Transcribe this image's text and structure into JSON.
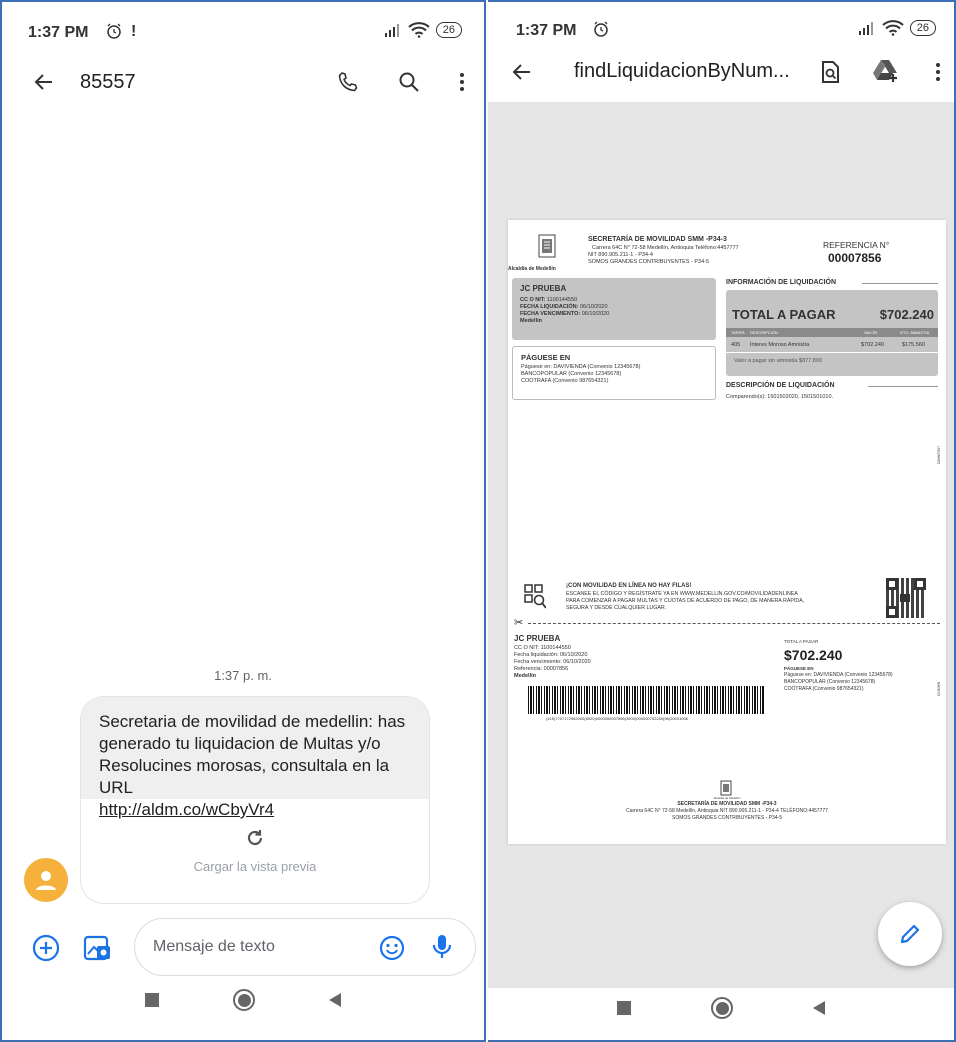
{
  "left_screen": {
    "status": {
      "time": "1:37 PM",
      "alarm_icon": "alarm-icon",
      "alert_mark": "!",
      "battery": "26"
    },
    "appbar": {
      "title": "85557"
    },
    "message": {
      "timestamp": "1:37 p. m.",
      "text": "Secretaria de movilidad de medellin: has generado tu liquidacion de Multas y/o Resolucines morosas, consultala en la URL",
      "link": "http://aldm.co/wCbyVr4",
      "preview_label": "Cargar la vista previa"
    },
    "compose": {
      "placeholder": "Mensaje de texto"
    }
  },
  "right_screen": {
    "status": {
      "time": "1:37 PM",
      "battery": "26"
    },
    "appbar": {
      "title": "findLiquidacionByNum..."
    },
    "doc": {
      "org": "SECRETARÍA DE MOVILIDAD SMM -P34-3",
      "addr1": "Carrera 64C N° 72-58 Medellín, Antioquia Teléfono:4457777",
      "addr2": "NIT 890.905.211-1 - P34-4",
      "addr3": "SOMOS GRANDES CONTRIBUYENTES - P34-5",
      "logo_caption": "Alcaldía de Medellín",
      "ref_label": "REFERENCIA N°",
      "ref_value": "00007856",
      "name": "JC PRUEBA",
      "nit_label": "CC O NIT:",
      "nit": "1100144550",
      "fl_label": "FECHA LIQUIDACIÓN:",
      "fl": "06/10/2020",
      "fv_label": "FECHA VENCIMIENTO:",
      "fv": "06/10/2020",
      "city": "Medellín",
      "info_title": "INFORMACIÓN DE LIQUIDACIÓN",
      "total_label": "TOTAL A PAGAR",
      "total": "$702.240",
      "th_tarifa": "TARIFA",
      "th_desc": "DESCRIPCIÓN",
      "th_valor": "VALOR",
      "th_dto": "DTO. AMNISTÍA",
      "row_tarifa": "405",
      "row_desc": "Interes Moroso Amnistía",
      "row_valor": "$702.240",
      "row_dto": "$175.560",
      "sin_amnistia": "Valor a pagar sin amnistía $877.800",
      "pague_title": "PÁGUESE EN",
      "pague1": "Páguese en: DAVIVIENDA (Convenio 12345678)",
      "pague2": "BANCOPOPULAR (Convenio 12345678)",
      "pague3": "COOTRAFA (Convenio 987654321)",
      "desc_title": "DESCRIPCIÓN DE LIQUIDACIÓN",
      "desc": "Comparendo(s): 1501502020, 1501501010.",
      "side1": "USUARIO",
      "promo_title": "¡CON MOVILIDAD EN LÍNEA NO HAY FILAS!",
      "promo1": "ESCANEE EL CÓDIGO Y REGÍSTRATE YA EN WWW.MEDELLIN.GOV.CO/MOVILIDADENLINEA",
      "promo2": "PARA COMENZAR A PAGAR MULTAS Y CUOTAS DE ACUERDO DE PAGO, DE MANERA RÁPIDA,",
      "promo3": "SEGURA Y DESDE CUALQUIER LUGAR.",
      "s_name": "JC PRUEBA",
      "s_nit": "CC O NIT: 1100144550",
      "s_fl": "Fecha liquidación: 06/10/2020",
      "s_fv": "Fecha vencimiento: 06/10/2020",
      "s_ref": "Referencia: 00007856",
      "s_city": "Medellín",
      "s_total_label": "TOTAL A PAGAR",
      "s_total": "$702.240",
      "s_pague_title": "PÁGUESE EN",
      "s_pague1": "Páguese en: DAVIVIENDA (Convenio 12345678)",
      "s_pague2": "BANCOPOPULAR (Convenio 12345678)",
      "s_pague3": "COOTRAFA (Convenio 987654321)",
      "barcode_text": "(415)7707172962000(8020)0000000007856(3900)000000702240(96)20201006",
      "side2": "BANCO",
      "footer_logo": "Alcaldía de Medellín",
      "footer1": "SECRETARÍA DE MOVILIDAD SMM -P34-3",
      "footer2": "Carrera 64C N° 72-58 Medellín, Antioquia NIT 890.905.211-1 - P34-4 TELÉFONO:4457777",
      "footer3": "SOMOS GRANDES CONTRIBUYENTES - P34-5"
    }
  },
  "colors": {
    "accent_blue": "#1a73e8",
    "avatar_orange": "#f6b13c",
    "frame_blue": "#3d6fb6"
  }
}
